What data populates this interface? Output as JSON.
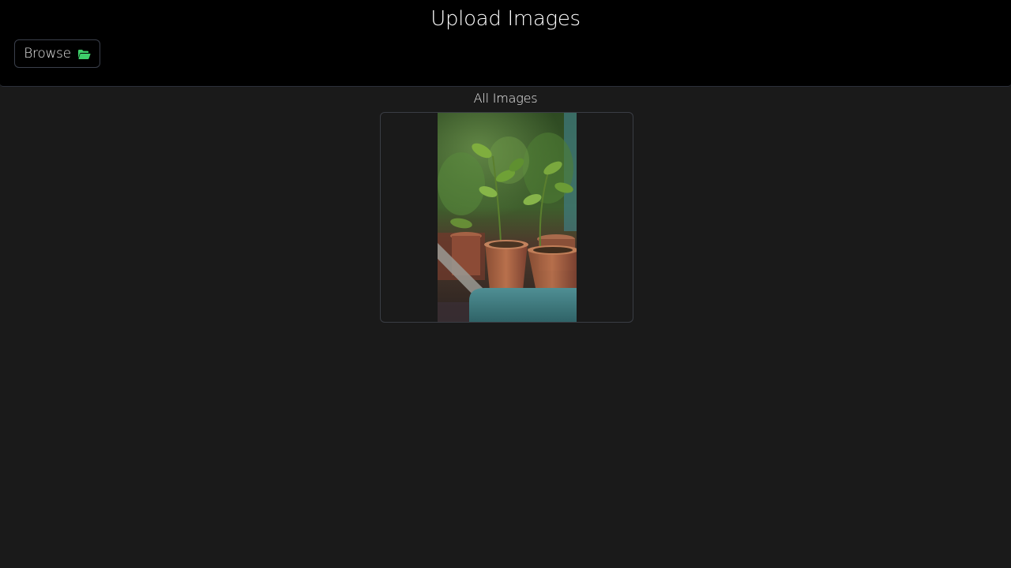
{
  "header": {
    "title": "Upload Images",
    "browse_button": {
      "label": "Browse",
      "icon": "folder-open-icon",
      "icon_color": "#3ecf6a"
    }
  },
  "gallery": {
    "title": "All Images",
    "images": [
      {
        "subject": "potted seedlings photo"
      }
    ]
  },
  "colors": {
    "header_bg": "#000000",
    "page_bg": "#1a1a1a",
    "border": "#3a3f4b"
  }
}
